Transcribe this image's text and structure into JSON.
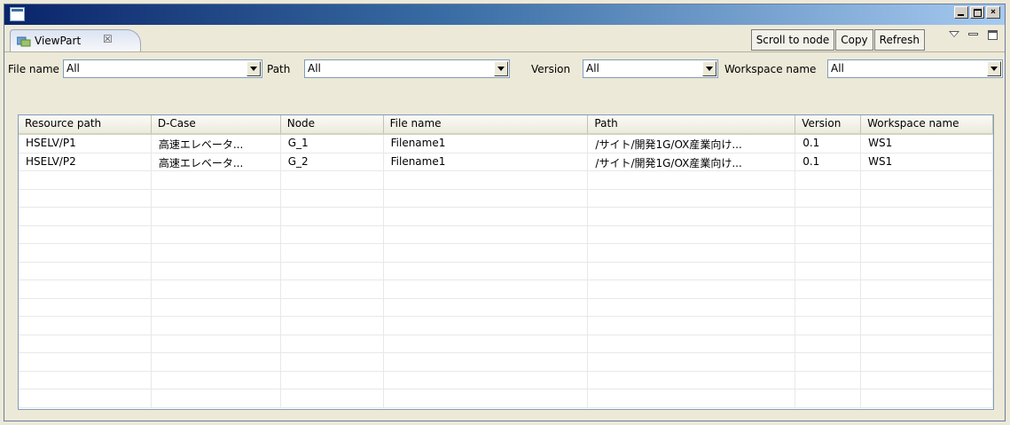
{
  "window": {
    "title": ""
  },
  "view": {
    "tab_label": "ViewPart",
    "tab_close": "☒",
    "buttons": {
      "scroll_to_node": "Scroll to node",
      "copy": "Copy",
      "refresh": "Refresh"
    }
  },
  "filters": {
    "file_name": {
      "label": "File name",
      "value": "All"
    },
    "path": {
      "label": "Path",
      "value": "All"
    },
    "version": {
      "label": "Version",
      "value": "All"
    },
    "workspace_name": {
      "label": "Workspace name",
      "value": "All"
    }
  },
  "table": {
    "columns": [
      "Resource path",
      "D-Case",
      "Node",
      "File name",
      "Path",
      "Version",
      "Workspace name"
    ],
    "rows": [
      [
        "HSELV/P1",
        "高速エレベータ...",
        "G_1",
        "Filename1",
        "/サイト/開発1G/OX産業向け...",
        "0.1",
        "WS1"
      ],
      [
        "HSELV/P2",
        "高速エレベータ...",
        "G_2",
        "Filename1",
        "/サイト/開発1G/OX産業向け...",
        "0.1",
        "WS1"
      ]
    ],
    "empty_rows": 13
  },
  "icons": {
    "window_icon": "window-icon",
    "view_icon": "viewpart-icon",
    "view_menu": "view-menu-icon",
    "minimize": "minimize-icon",
    "maximize": "maximize-icon",
    "close": "close-icon"
  }
}
